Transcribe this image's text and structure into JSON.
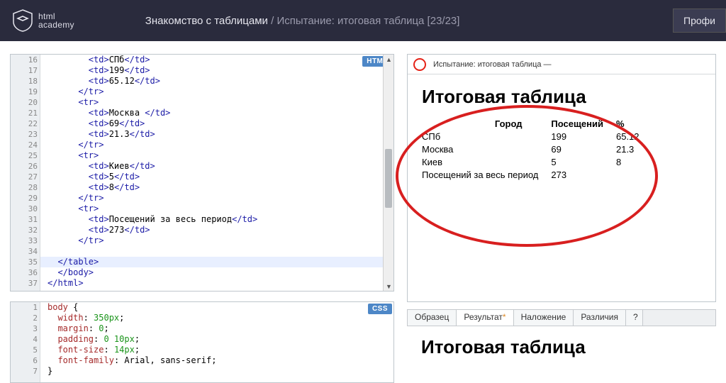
{
  "header": {
    "logo_top": "html",
    "logo_bottom": "academy",
    "bc1": "Знакомство с таблицами",
    "bc_sep": " / ",
    "bc2": "Испытание: итоговая таблица  [23/23]",
    "profile": "Профи"
  },
  "editors": {
    "html_badge": "HTML",
    "css_badge": "CSS",
    "html_lines": [
      {
        "n": 16,
        "indent": 4,
        "parts": [
          [
            "tag",
            "<td>"
          ],
          [
            "txt",
            "СПб"
          ],
          [
            "tag",
            "</td>"
          ]
        ]
      },
      {
        "n": 17,
        "indent": 4,
        "parts": [
          [
            "tag",
            "<td>"
          ],
          [
            "txt",
            "199"
          ],
          [
            "tag",
            "</td>"
          ]
        ]
      },
      {
        "n": 18,
        "indent": 4,
        "parts": [
          [
            "tag",
            "<td>"
          ],
          [
            "txt",
            "65.12"
          ],
          [
            "tag",
            "</td>"
          ]
        ]
      },
      {
        "n": 19,
        "indent": 3,
        "parts": [
          [
            "tag",
            "</tr>"
          ]
        ]
      },
      {
        "n": 20,
        "indent": 3,
        "parts": [
          [
            "tag",
            "<tr>"
          ]
        ]
      },
      {
        "n": 21,
        "indent": 4,
        "parts": [
          [
            "tag",
            "<td>"
          ],
          [
            "txt",
            "Москва "
          ],
          [
            "tag",
            "</td>"
          ]
        ]
      },
      {
        "n": 22,
        "indent": 4,
        "parts": [
          [
            "tag",
            "<td>"
          ],
          [
            "txt",
            "69"
          ],
          [
            "tag",
            "</td>"
          ]
        ]
      },
      {
        "n": 23,
        "indent": 4,
        "parts": [
          [
            "tag",
            "<td>"
          ],
          [
            "txt",
            "21.3"
          ],
          [
            "tag",
            "</td>"
          ]
        ]
      },
      {
        "n": 24,
        "indent": 3,
        "parts": [
          [
            "tag",
            "</tr>"
          ]
        ]
      },
      {
        "n": 25,
        "indent": 3,
        "parts": [
          [
            "tag",
            "<tr>"
          ]
        ]
      },
      {
        "n": 26,
        "indent": 4,
        "parts": [
          [
            "tag",
            "<td>"
          ],
          [
            "txt",
            "Киев"
          ],
          [
            "tag",
            "</td>"
          ]
        ]
      },
      {
        "n": 27,
        "indent": 4,
        "parts": [
          [
            "tag",
            "<td>"
          ],
          [
            "txt",
            "5"
          ],
          [
            "tag",
            "</td>"
          ]
        ]
      },
      {
        "n": 28,
        "indent": 4,
        "parts": [
          [
            "tag",
            "<td>"
          ],
          [
            "txt",
            "8"
          ],
          [
            "tag",
            "</td>"
          ]
        ]
      },
      {
        "n": 29,
        "indent": 3,
        "parts": [
          [
            "tag",
            "</tr>"
          ]
        ]
      },
      {
        "n": 30,
        "indent": 3,
        "parts": [
          [
            "tag",
            "<tr>"
          ]
        ]
      },
      {
        "n": 31,
        "indent": 4,
        "parts": [
          [
            "tag",
            "<td>"
          ],
          [
            "txt",
            "Посещений за весь период"
          ],
          [
            "tag",
            "</td>"
          ]
        ]
      },
      {
        "n": 32,
        "indent": 4,
        "parts": [
          [
            "tag",
            "<td>"
          ],
          [
            "txt",
            "273"
          ],
          [
            "tag",
            "</td>"
          ]
        ]
      },
      {
        "n": 33,
        "indent": 3,
        "parts": [
          [
            "tag",
            "</tr>"
          ]
        ]
      },
      {
        "n": 34,
        "indent": 3,
        "parts": []
      },
      {
        "n": 35,
        "indent": 1,
        "active": true,
        "parts": [
          [
            "tag",
            "</table>"
          ]
        ]
      },
      {
        "n": 36,
        "indent": 1,
        "parts": [
          [
            "tag",
            "</body>"
          ]
        ]
      },
      {
        "n": 37,
        "indent": 0,
        "parts": [
          [
            "tag",
            "</html>"
          ]
        ]
      }
    ],
    "css_lines": [
      {
        "n": 1,
        "indent": 0,
        "parts": [
          [
            "attr",
            "body"
          ],
          [
            "txt",
            " "
          ],
          [
            "punct",
            "{"
          ]
        ]
      },
      {
        "n": 2,
        "indent": 1,
        "parts": [
          [
            "attr",
            "width"
          ],
          [
            "punct",
            ": "
          ],
          [
            "val",
            "350px"
          ],
          [
            "punct",
            ";"
          ]
        ]
      },
      {
        "n": 3,
        "indent": 1,
        "parts": [
          [
            "attr",
            "margin"
          ],
          [
            "punct",
            ": "
          ],
          [
            "val",
            "0"
          ],
          [
            "punct",
            ";"
          ]
        ]
      },
      {
        "n": 4,
        "indent": 1,
        "parts": [
          [
            "attr",
            "padding"
          ],
          [
            "punct",
            ": "
          ],
          [
            "val",
            "0 10px"
          ],
          [
            "punct",
            ";"
          ]
        ]
      },
      {
        "n": 5,
        "indent": 1,
        "parts": [
          [
            "attr",
            "font-size"
          ],
          [
            "punct",
            ": "
          ],
          [
            "val",
            "14px"
          ],
          [
            "punct",
            ";"
          ]
        ]
      },
      {
        "n": 6,
        "indent": 1,
        "parts": [
          [
            "attr",
            "font-family"
          ],
          [
            "punct",
            ": "
          ],
          [
            "txt",
            "Arial"
          ],
          [
            "punct",
            ", "
          ],
          [
            "txt",
            "sans-serif"
          ],
          [
            "punct",
            ";"
          ]
        ]
      },
      {
        "n": 7,
        "indent": 0,
        "parts": [
          [
            "punct",
            "}"
          ]
        ]
      }
    ]
  },
  "preview": {
    "url": "Испытание: итоговая таблица —",
    "title": "Итоговая таблица",
    "th_city": "Город",
    "th_visits": "Посещений",
    "th_pct": "%",
    "rows": [
      [
        "СПб",
        "199",
        "65.12"
      ],
      [
        "Москва",
        "69",
        "21.3"
      ],
      [
        "Киев",
        "5",
        "8"
      ]
    ],
    "footer_label": "Посещений за весь период",
    "footer_value": "273"
  },
  "tabs": {
    "t1": "Образец",
    "t2": "Результат",
    "t3": "Наложение",
    "t4": "Различия",
    "t5": "?"
  },
  "below_title": "Итоговая таблица"
}
